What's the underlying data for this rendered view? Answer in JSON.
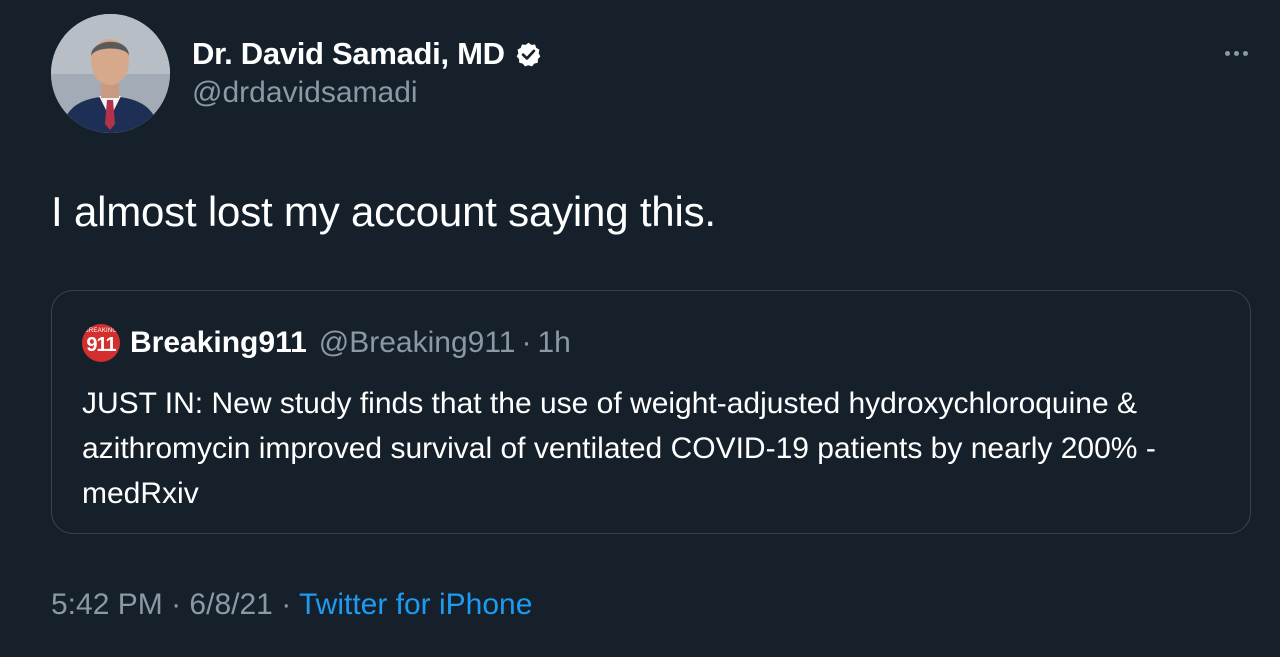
{
  "author": {
    "name": "Dr. David Samadi, MD",
    "handle": "@drdavidsamadi",
    "verified": true
  },
  "tweet": {
    "text": "I almost lost my account saying this."
  },
  "quote": {
    "avatar_small_text": "BREAKING",
    "avatar_big_text": "911",
    "name": "Breaking911",
    "handle": "@Breaking911",
    "separator": "·",
    "time": "1h",
    "text": "JUST IN: New study finds that the use of weight-adjusted hydroxychloroquine & azithromycin improved survival of ventilated COVID-19 patients by nearly 200% - medRxiv"
  },
  "meta": {
    "time": "5:42 PM",
    "separator": "·",
    "date": "6/8/21",
    "separator2": "·",
    "source": "Twitter for iPhone"
  },
  "icons": {
    "verified": "verified-badge-icon",
    "more": "more-horizontal-icon"
  },
  "colors": {
    "background": "#15202b",
    "secondary_text": "#8b98a5",
    "link": "#1d9bf0",
    "border": "#38444d",
    "quote_avatar": "#d32f2f"
  }
}
